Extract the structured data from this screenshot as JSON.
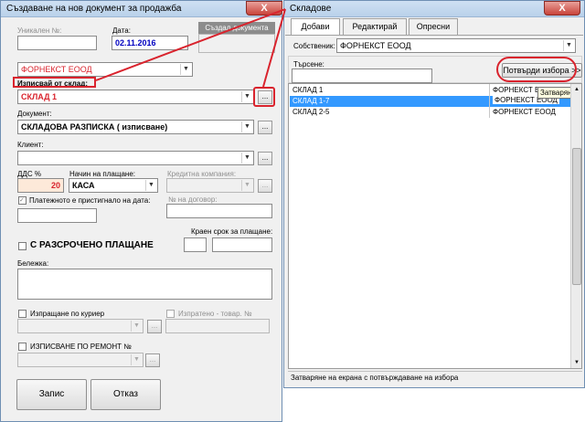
{
  "main": {
    "title": "Създаване на нов документ за продажба",
    "close": "X",
    "unique_no_label": "Уникален №:",
    "unique_no_value": "",
    "date_label": "Дата:",
    "date_value": "02.11.2016",
    "created_by": "Създал документа",
    "company_value": "ФОРНЕКСТ ЕООД",
    "warehouse_label": "Изписвай от склад:",
    "warehouse_value": "СКЛАД 1",
    "browse": "...",
    "document_label": "Документ:",
    "document_value": "СКЛАДОВА РАЗПИСКА ( изписване)",
    "client_label": "Клиент:",
    "client_value": "",
    "vat_label": "ДДС %",
    "vat_value": "20",
    "payment_label": "Начин на плащане:",
    "payment_value": "КАСА",
    "credit_label": "Кредитна компания:",
    "paid_label": "Платежното е пристигнало на дата:",
    "contract_label": "№ на договор:",
    "due_label": "Краен срок за плащане:",
    "installment_label": "С РАЗСРОЧЕНО ПЛАЩАНЕ",
    "note_label": "Бележка:",
    "courier_label": "Изпращане по куриер",
    "sent_label": "Изпратено - товар. №",
    "repair_label": "ИЗПИСВАНЕ ПО РЕМОНТ №",
    "save_label": "Запис",
    "cancel_label": "Отказ"
  },
  "dialog": {
    "title": "Складове",
    "close": "X",
    "tabs": [
      "Добави",
      "Редактирай",
      "Опресни"
    ],
    "owner_label": "Собственик:",
    "owner_value": "ФОРНЕКСТ ЕООД",
    "search_label": "Търсене:",
    "search_value": "",
    "confirm_label": "Потвърди избора >>",
    "tooltip": "Затваряне на",
    "rows": [
      {
        "name": "СКЛАД 1",
        "owner": "ФОРНЕКСТ Е"
      },
      {
        "name": "СКЛАД 1-7",
        "owner": "ФОРНЕКСТ ЕООД"
      },
      {
        "name": "СКЛАД 2-5",
        "owner": "ФОРНЕКСТ ЕООД"
      }
    ],
    "status": "Затваряне на екрана с потвърждаване на избора"
  },
  "colors": {
    "accent_red": "#d9232d",
    "selection": "#3399ff",
    "date_blue": "#0000c0"
  }
}
